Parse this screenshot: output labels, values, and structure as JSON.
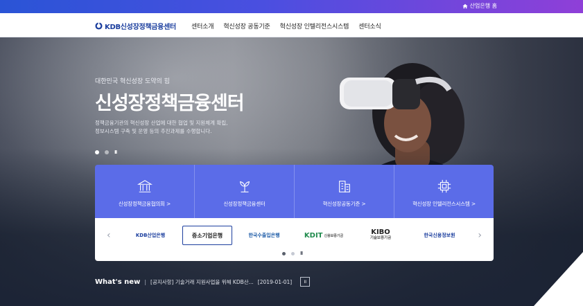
{
  "topbar": {
    "home_label": "산업은행 홈"
  },
  "header": {
    "logo_text": "KDB신성장정책금융센터",
    "nav": [
      "센터소개",
      "혁신성장 공동기준",
      "혁신성장 인텔리전스시스템",
      "센터소식"
    ]
  },
  "hero": {
    "eyebrow": "대한민국 혁신성장 도약의 힘",
    "title": "신성장정책금융센터",
    "desc_line1": "정책금융기관의 혁신성장 산업에 대한 협업 및 지원체계 확립,",
    "desc_line2": "정보시스템 구축 및 운영 등의 추진과제를 수행합니다.",
    "pause": "II"
  },
  "features": [
    {
      "icon": "bank-icon",
      "label": "신성장정책금융협의회 >"
    },
    {
      "icon": "sprout-icon",
      "label": "신성장정책금융센터"
    },
    {
      "icon": "building-icon",
      "label": "혁신성장공동기준 >"
    },
    {
      "icon": "chip-icon",
      "label": "혁신성장 인텔리전스시스템 >"
    }
  ],
  "partners": [
    "KDB산업은행",
    "중소기업은행",
    "한국수출입은행",
    "KDIT",
    "KIBO",
    "한국신용정보원"
  ],
  "partner_subs": {
    "kdit": "신용보증기금",
    "kibo": "기술보증기금"
  },
  "whatsnew": {
    "title": "What's new",
    "item": "[공지사항]  기술거래 지원사업을 위해 KDB산...",
    "date": "[2019-01-01]",
    "pause": "II"
  },
  "colors": {
    "accent": "#5b6ce8",
    "brand": "#1b3e9e"
  }
}
